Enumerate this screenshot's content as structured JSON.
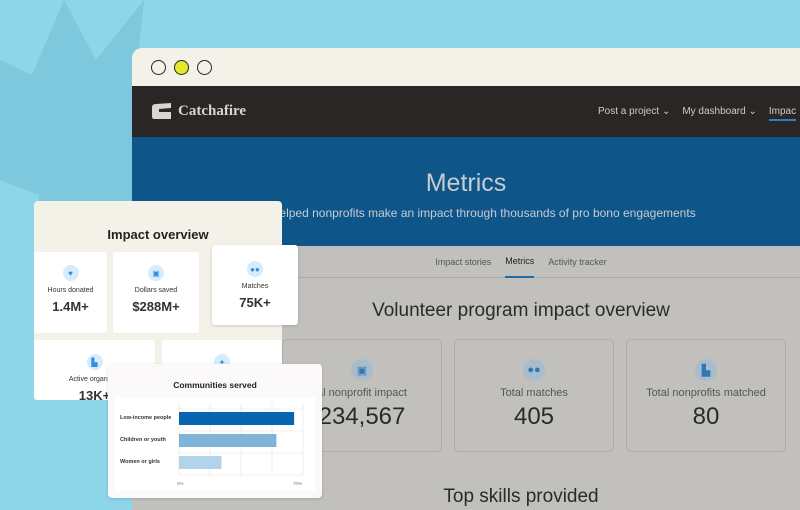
{
  "window": {
    "controls": [
      "close",
      "minimize",
      "maximize"
    ]
  },
  "nav": {
    "brand": "Catchafire",
    "links": [
      {
        "label": "Post a project"
      },
      {
        "label": "My dashboard"
      },
      {
        "label": "Impac"
      }
    ]
  },
  "hero": {
    "title": "Metrics",
    "subtitle": "We’ve helped nonprofits make an impact through thousands of pro bono engagements"
  },
  "tabs": [
    {
      "label": "Impact stories"
    },
    {
      "label": "Metrics",
      "active": true
    },
    {
      "label": "Activity tracker"
    }
  ],
  "main": {
    "title": "Volunteer program impact overview",
    "stats": [
      {
        "label": "al nonprofit impact",
        "value": "234,567",
        "icon": "money-icon"
      },
      {
        "label": "Total matches",
        "value": "405",
        "icon": "people-icon"
      },
      {
        "label": "Total nonprofits matched",
        "value": "80",
        "icon": "building-icon"
      }
    ],
    "next_section": "Top skills provided"
  },
  "overview": {
    "title": "Impact overview",
    "cards": [
      {
        "label": "Hours donated",
        "value": "1.4M+",
        "icon": "hand-heart-icon"
      },
      {
        "label": "Dollars saved",
        "value": "$288M+",
        "icon": "money-icon"
      },
      {
        "label": "Matches",
        "value": "75K+",
        "icon": "people-icon"
      },
      {
        "label": "Active organizati",
        "value": "13K+",
        "icon": "building-icon"
      },
      {
        "label": "",
        "value": "",
        "icon": "star-icon"
      }
    ]
  },
  "chart_data": {
    "type": "bar",
    "orientation": "horizontal",
    "title": "Communities served",
    "categories": [
      "Low-income people",
      "Children or youth",
      "Women or girls"
    ],
    "values": [
      65,
      55,
      24
    ],
    "unit": "%",
    "xlim": [
      0,
      70
    ],
    "tick_labels": [
      "0%",
      "70%"
    ],
    "grid": true,
    "colors": [
      "#0865b1",
      "#80b3da",
      "#b3d3ea"
    ]
  },
  "colors": {
    "background": "#8dd6e9",
    "nav": "#2a2625",
    "hero": "#0e5589",
    "accent": "#1f6aa8"
  }
}
